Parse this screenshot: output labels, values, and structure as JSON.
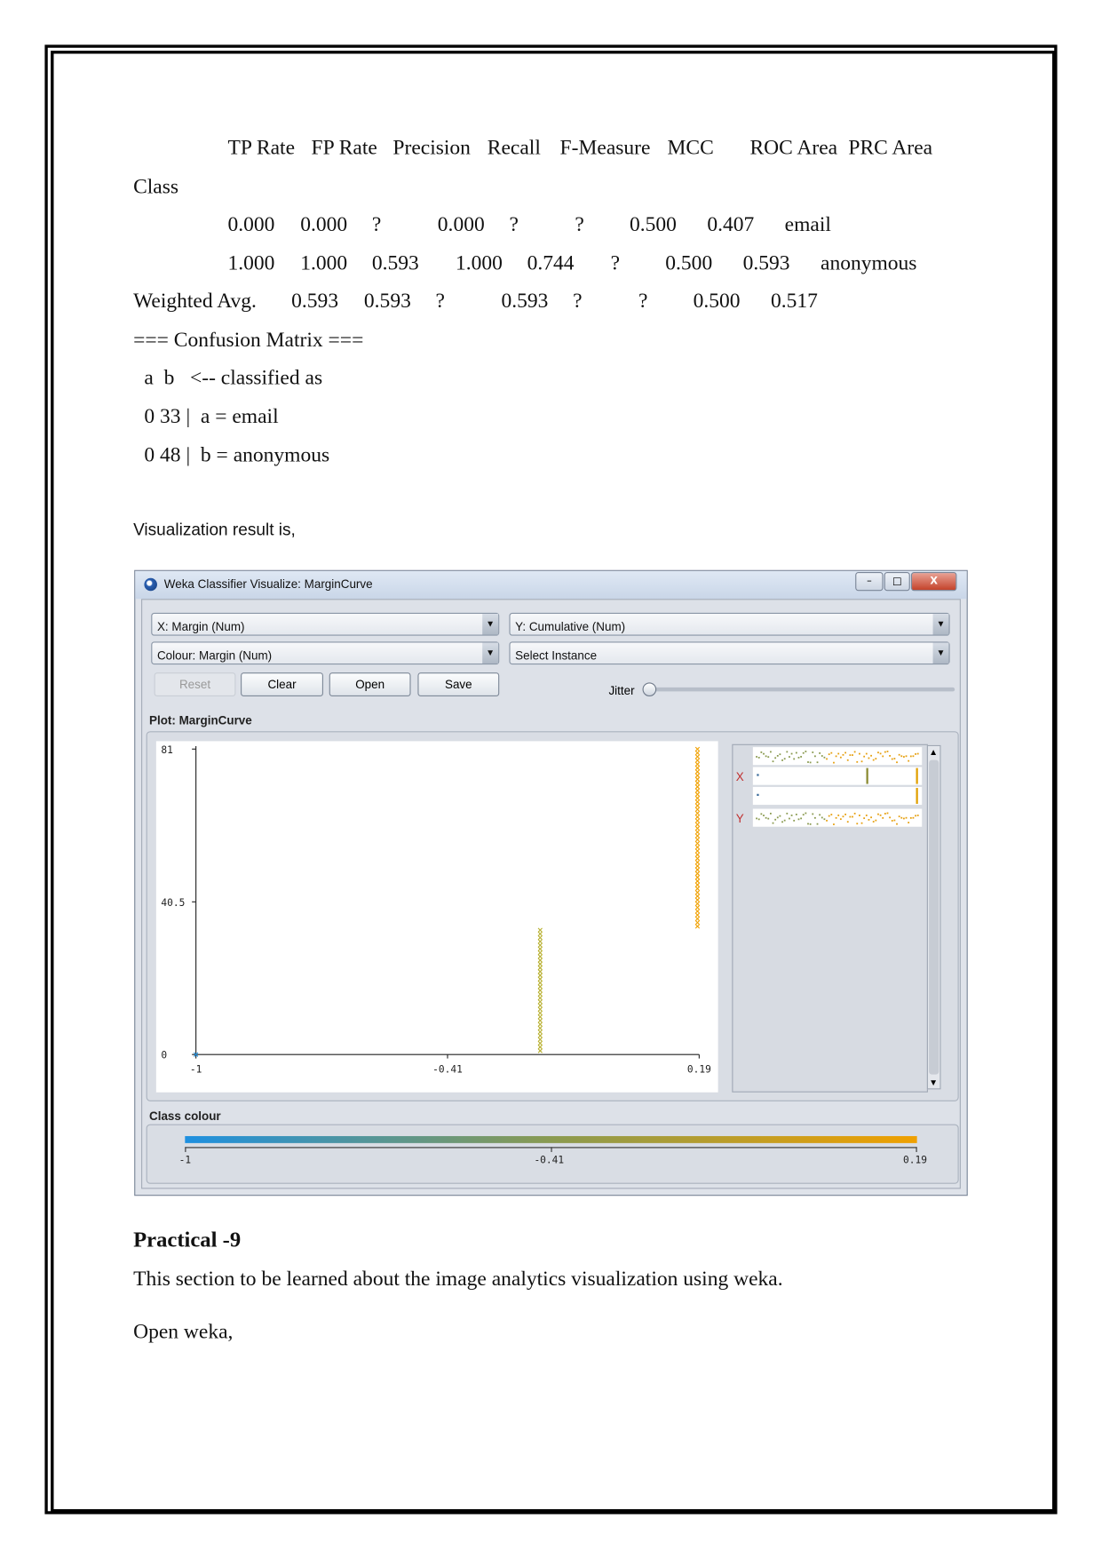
{
  "metrics": {
    "headers": [
      "TP Rate",
      "FP Rate",
      "Precision",
      "Recall",
      "F-Measure",
      "MCC",
      "ROC Area",
      "PRC Area"
    ],
    "class_label": "Class",
    "rows": [
      [
        "0.000",
        "0.000",
        "?",
        "0.000",
        "?",
        "?",
        "0.500",
        "0.407",
        "email"
      ],
      [
        "1.000",
        "1.000",
        "0.593",
        "1.000",
        "0.744",
        "?",
        "0.500",
        "0.593",
        "anonymous"
      ]
    ],
    "weighted": [
      "Weighted Avg.",
      "0.593",
      "0.593",
      "?",
      "0.593",
      "?",
      "?",
      "0.500",
      "0.517"
    ]
  },
  "confusion": {
    "title": "=== Confusion Matrix ===",
    "header": "a  b   <-- classified as",
    "rows": [
      "0 33 |  a = email",
      "0 48 |  b = anonymous"
    ]
  },
  "viz_intro": "Visualization result is,",
  "window": {
    "title": "Weka Classifier Visualize: MarginCurve",
    "controls": {
      "minimize": "–",
      "maximize": "□",
      "close": "X"
    },
    "x_combo": "X: Margin (Num)",
    "y_combo": "Y: Cumulative (Num)",
    "colour_combo": "Colour: Margin (Num)",
    "select_instance": "Select Instance",
    "buttons": {
      "reset": "Reset",
      "clear": "Clear",
      "open": "Open",
      "save": "Save"
    },
    "jitter_label": "Jitter",
    "jitter_value": 0,
    "plot_label": "Plot: MarginCurve",
    "attr_x": "X",
    "attr_y": "Y",
    "class_colour_label": "Class colour",
    "class_colour_ticks": [
      "-1",
      "-0.41",
      "0.19"
    ],
    "colors": {
      "low": "#1e90e0",
      "mid": "#8a9a50",
      "high": "#f0a000"
    }
  },
  "chart_data": {
    "type": "scatter",
    "x_ticks": [
      "-1",
      "-0.41",
      "0.19"
    ],
    "y_ticks": [
      "81",
      "40.5",
      "0"
    ],
    "xlim": [
      -1,
      0.19
    ],
    "ylim": [
      0,
      81
    ],
    "groups": [
      {
        "x": -1,
        "cumulative_range": [
          0,
          0
        ]
      },
      {
        "x": -0.186,
        "cumulative_range": [
          1,
          33
        ]
      },
      {
        "x": 0.186,
        "cumulative_range": [
          34,
          81
        ]
      }
    ]
  },
  "practical": {
    "heading": "Practical -9",
    "text": "This section to be learned about the image analytics visualization using weka.",
    "open": "Open weka,"
  }
}
